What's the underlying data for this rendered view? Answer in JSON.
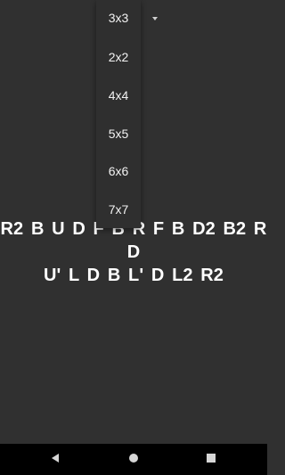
{
  "puzzle_select": {
    "options": [
      "3x3",
      "2x2",
      "4x4",
      "5x5",
      "6x6",
      "7x7"
    ]
  },
  "scramble": {
    "line1": "R2 B U D F B R F B D2 B2 R D",
    "line2": "U' L D B L' D L2 R2"
  },
  "colors": {
    "background": "#303030",
    "menu_background": "#2f2f2f",
    "navbar_background": "#000000",
    "text": "#ffffff"
  },
  "nav": {
    "back_icon": "back-triangle-icon",
    "home_icon": "home-circle-icon",
    "recents_icon": "recents-square-icon"
  }
}
